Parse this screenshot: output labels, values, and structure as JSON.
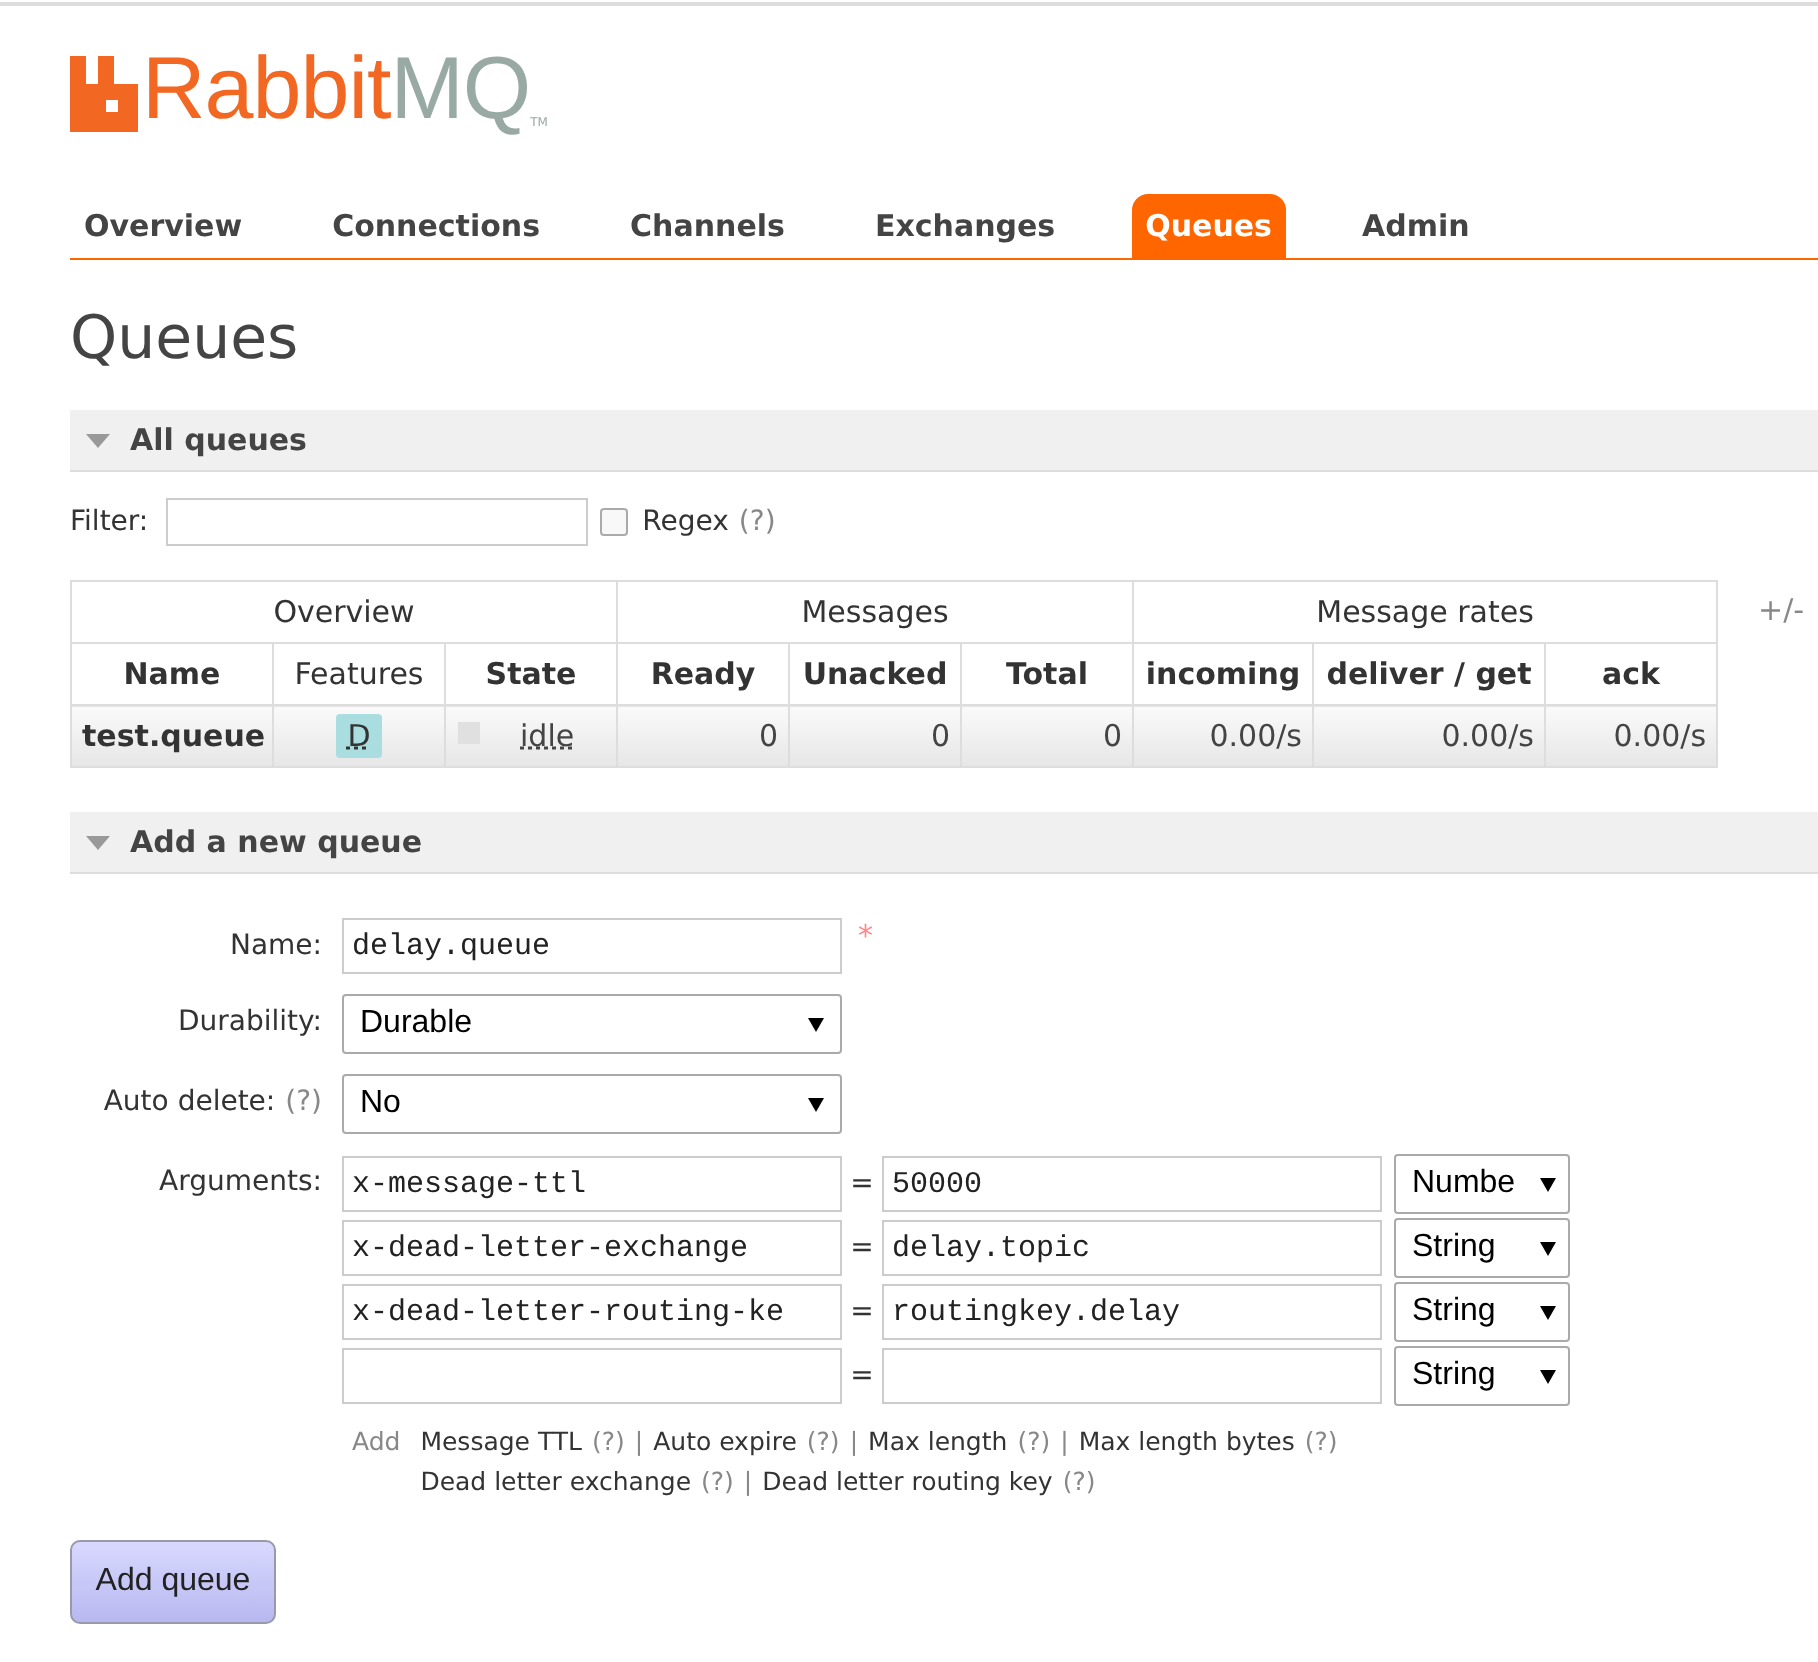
{
  "logo": {
    "brand": "Rabbit",
    "brand_suffix": "MQ",
    "trademark": "TM"
  },
  "nav": [
    {
      "label": "Overview",
      "selected": false
    },
    {
      "label": "Connections",
      "selected": false
    },
    {
      "label": "Channels",
      "selected": false
    },
    {
      "label": "Exchanges",
      "selected": false
    },
    {
      "label": "Queues",
      "selected": true
    },
    {
      "label": "Admin",
      "selected": false
    }
  ],
  "page_title": "Queues",
  "all_queues": {
    "title": "All queues",
    "expanded": true,
    "filter": {
      "label": "Filter:"
    },
    "regex": {
      "label": "Regex",
      "help": "(?)",
      "checked": false
    },
    "table": {
      "groups": [
        {
          "label": "Overview"
        },
        {
          "label": "Messages"
        },
        {
          "label": "Message rates"
        }
      ],
      "columns_toggle": "+/-",
      "columns": [
        "Name",
        "Features",
        "State",
        "Ready",
        "Unacked",
        "Total",
        "incoming",
        "deliver / get",
        "ack"
      ],
      "rows": [
        {
          "name": "test.queue",
          "features": "D",
          "state": "idle",
          "values": [
            "0",
            "0",
            "0",
            "0.00/s",
            "0.00/s",
            "0.00/s"
          ]
        }
      ]
    }
  },
  "add_queue": {
    "title": "Add a new queue",
    "expanded": true,
    "name": {
      "label": "Name:",
      "value": "delay.queue",
      "required_mark": "*"
    },
    "durability": {
      "label": "Durability:",
      "value": "Durable"
    },
    "auto_delete": {
      "label": "Auto delete:",
      "help": "(?)",
      "value": "No"
    },
    "arguments": {
      "label": "Arguments:",
      "equals": "=",
      "rows": [
        {
          "key": "x-message-ttl",
          "value": "50000",
          "type": "Numbe"
        },
        {
          "key": "x-dead-letter-exchange",
          "value": "delay.topic",
          "type": "String"
        },
        {
          "key": "x-dead-letter-routing-ke",
          "value": "routingkey.delay",
          "type": "String"
        },
        {
          "type": "String"
        }
      ]
    },
    "hints": {
      "label": "Add",
      "separator": "|",
      "lines": [
        [
          {
            "label": "Message TTL",
            "help": "(?)"
          },
          {
            "label": "Auto expire",
            "help": "(?)"
          },
          {
            "label": "Max length",
            "help": "(?)"
          },
          {
            "label": "Max length bytes",
            "help": "(?)"
          }
        ],
        [
          {
            "label": "Dead letter exchange",
            "help": "(?)"
          },
          {
            "label": "Dead letter routing key",
            "help": "(?)"
          }
        ]
      ]
    },
    "submit": "Add queue"
  }
}
